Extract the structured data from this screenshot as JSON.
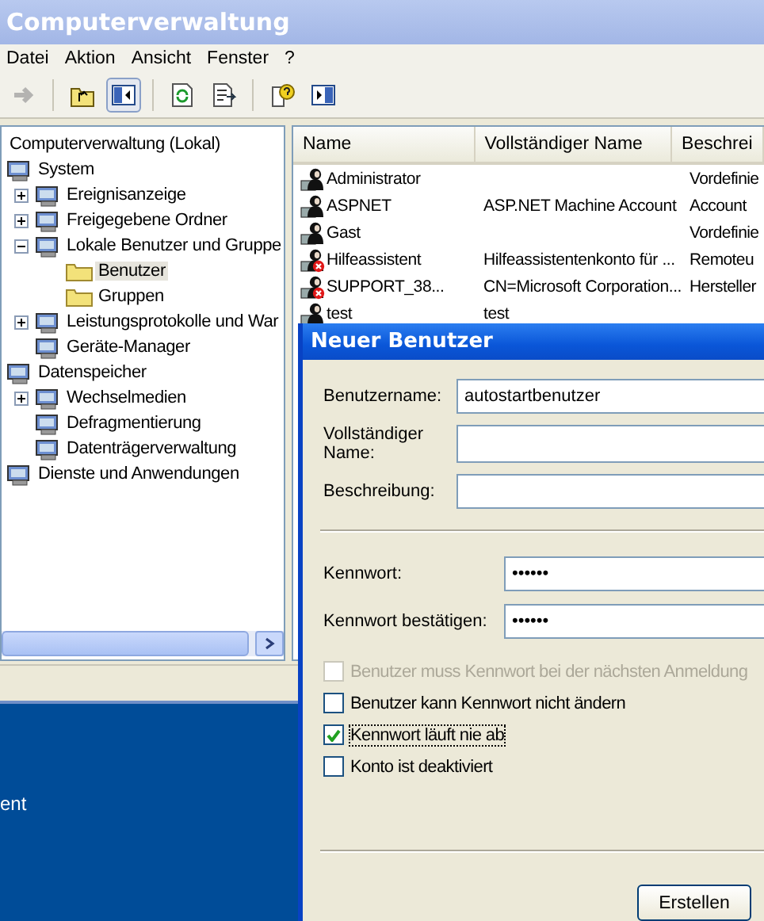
{
  "window": {
    "title": "Computerverwaltung"
  },
  "menu": [
    "Datei",
    "Aktion",
    "Ansicht",
    "Fenster",
    "?"
  ],
  "toolbar": [
    {
      "disabled": true,
      "pressed": false
    },
    {
      "disabled": false,
      "pressed": false
    },
    {
      "disabled": false,
      "pressed": true
    },
    {
      "disabled": false,
      "pressed": false
    },
    {
      "disabled": false,
      "pressed": false
    },
    {
      "disabled": false,
      "pressed": false
    },
    {
      "disabled": false,
      "pressed": false
    }
  ],
  "tree": [
    {
      "label": "Computerverwaltung (Lokal)",
      "selected": false,
      "children": [
        {
          "label": "System",
          "selected": false,
          "children": [
            {
              "label": "Ereignisanzeige",
              "expanded": false,
              "selected": false
            },
            {
              "label": "Freigegebene Ordner",
              "expanded": false,
              "selected": false
            },
            {
              "label": "Lokale Benutzer und Gruppe",
              "expanded": true,
              "selected": false,
              "children": [
                {
                  "label": "Benutzer",
                  "selected": true
                },
                {
                  "label": "Gruppen",
                  "selected": false
                }
              ]
            },
            {
              "label": "Leistungsprotokolle und War",
              "expanded": false,
              "selected": false
            },
            {
              "label": "Geräte-Manager",
              "selected": false
            }
          ]
        },
        {
          "label": "Datenspeicher",
          "selected": false,
          "children": [
            {
              "label": "Wechselmedien",
              "expanded": false,
              "selected": false
            },
            {
              "label": "Defragmentierung",
              "selected": false
            },
            {
              "label": "Datenträgerverwaltung",
              "selected": false
            }
          ]
        },
        {
          "label": "Dienste und Anwendungen",
          "selected": false
        }
      ]
    }
  ],
  "table": {
    "columns": [
      "Name",
      "Vollständiger Name",
      "Beschrei"
    ],
    "rows": [
      {
        "name": "Administrator",
        "description": "Vordefinie",
        "disabled": false
      },
      {
        "name": "ASPNET",
        "full_name": "ASP.NET Machine Account",
        "description": "Account",
        "disabled": false
      },
      {
        "name": "Gast",
        "description": "Vordefinie",
        "disabled": false
      },
      {
        "name": "Hilfeassistent",
        "full_name": "Hilfeassistentenkonto für ...",
        "description": "Remoteu",
        "disabled": true
      },
      {
        "name": "SUPPORT_38...",
        "full_name": "CN=Microsoft Corporation...",
        "description": "Hersteller",
        "disabled": true
      },
      {
        "name": "test",
        "full_name": "test",
        "disabled": false
      }
    ]
  },
  "desktop": {
    "text": "ent"
  },
  "dialog": {
    "title": "Neuer Benutzer",
    "fields": [
      {
        "label": "Benutzername:",
        "value": "autostartbenutzer",
        "kind": "text"
      },
      {
        "label": "Vollständiger Name:",
        "kind": "text"
      },
      {
        "label": "Beschreibung:",
        "kind": "text"
      },
      {
        "label": "Kennwort:",
        "value": "••••••",
        "kind": "password"
      },
      {
        "label": "Kennwort bestätigen:",
        "value": "••••••",
        "kind": "password"
      }
    ],
    "checkboxes": [
      {
        "label": "Benutzer muss Kennwort bei der nächsten Anmeldung",
        "checked": false,
        "disabled": true
      },
      {
        "label": "Benutzer kann Kennwort nicht ändern",
        "checked": false,
        "disabled": false
      },
      {
        "label": "Kennwort läuft nie ab",
        "checked": true,
        "disabled": false
      },
      {
        "label": "Konto ist deaktiviert",
        "checked": false,
        "disabled": false
      }
    ],
    "button": "Erstellen"
  }
}
